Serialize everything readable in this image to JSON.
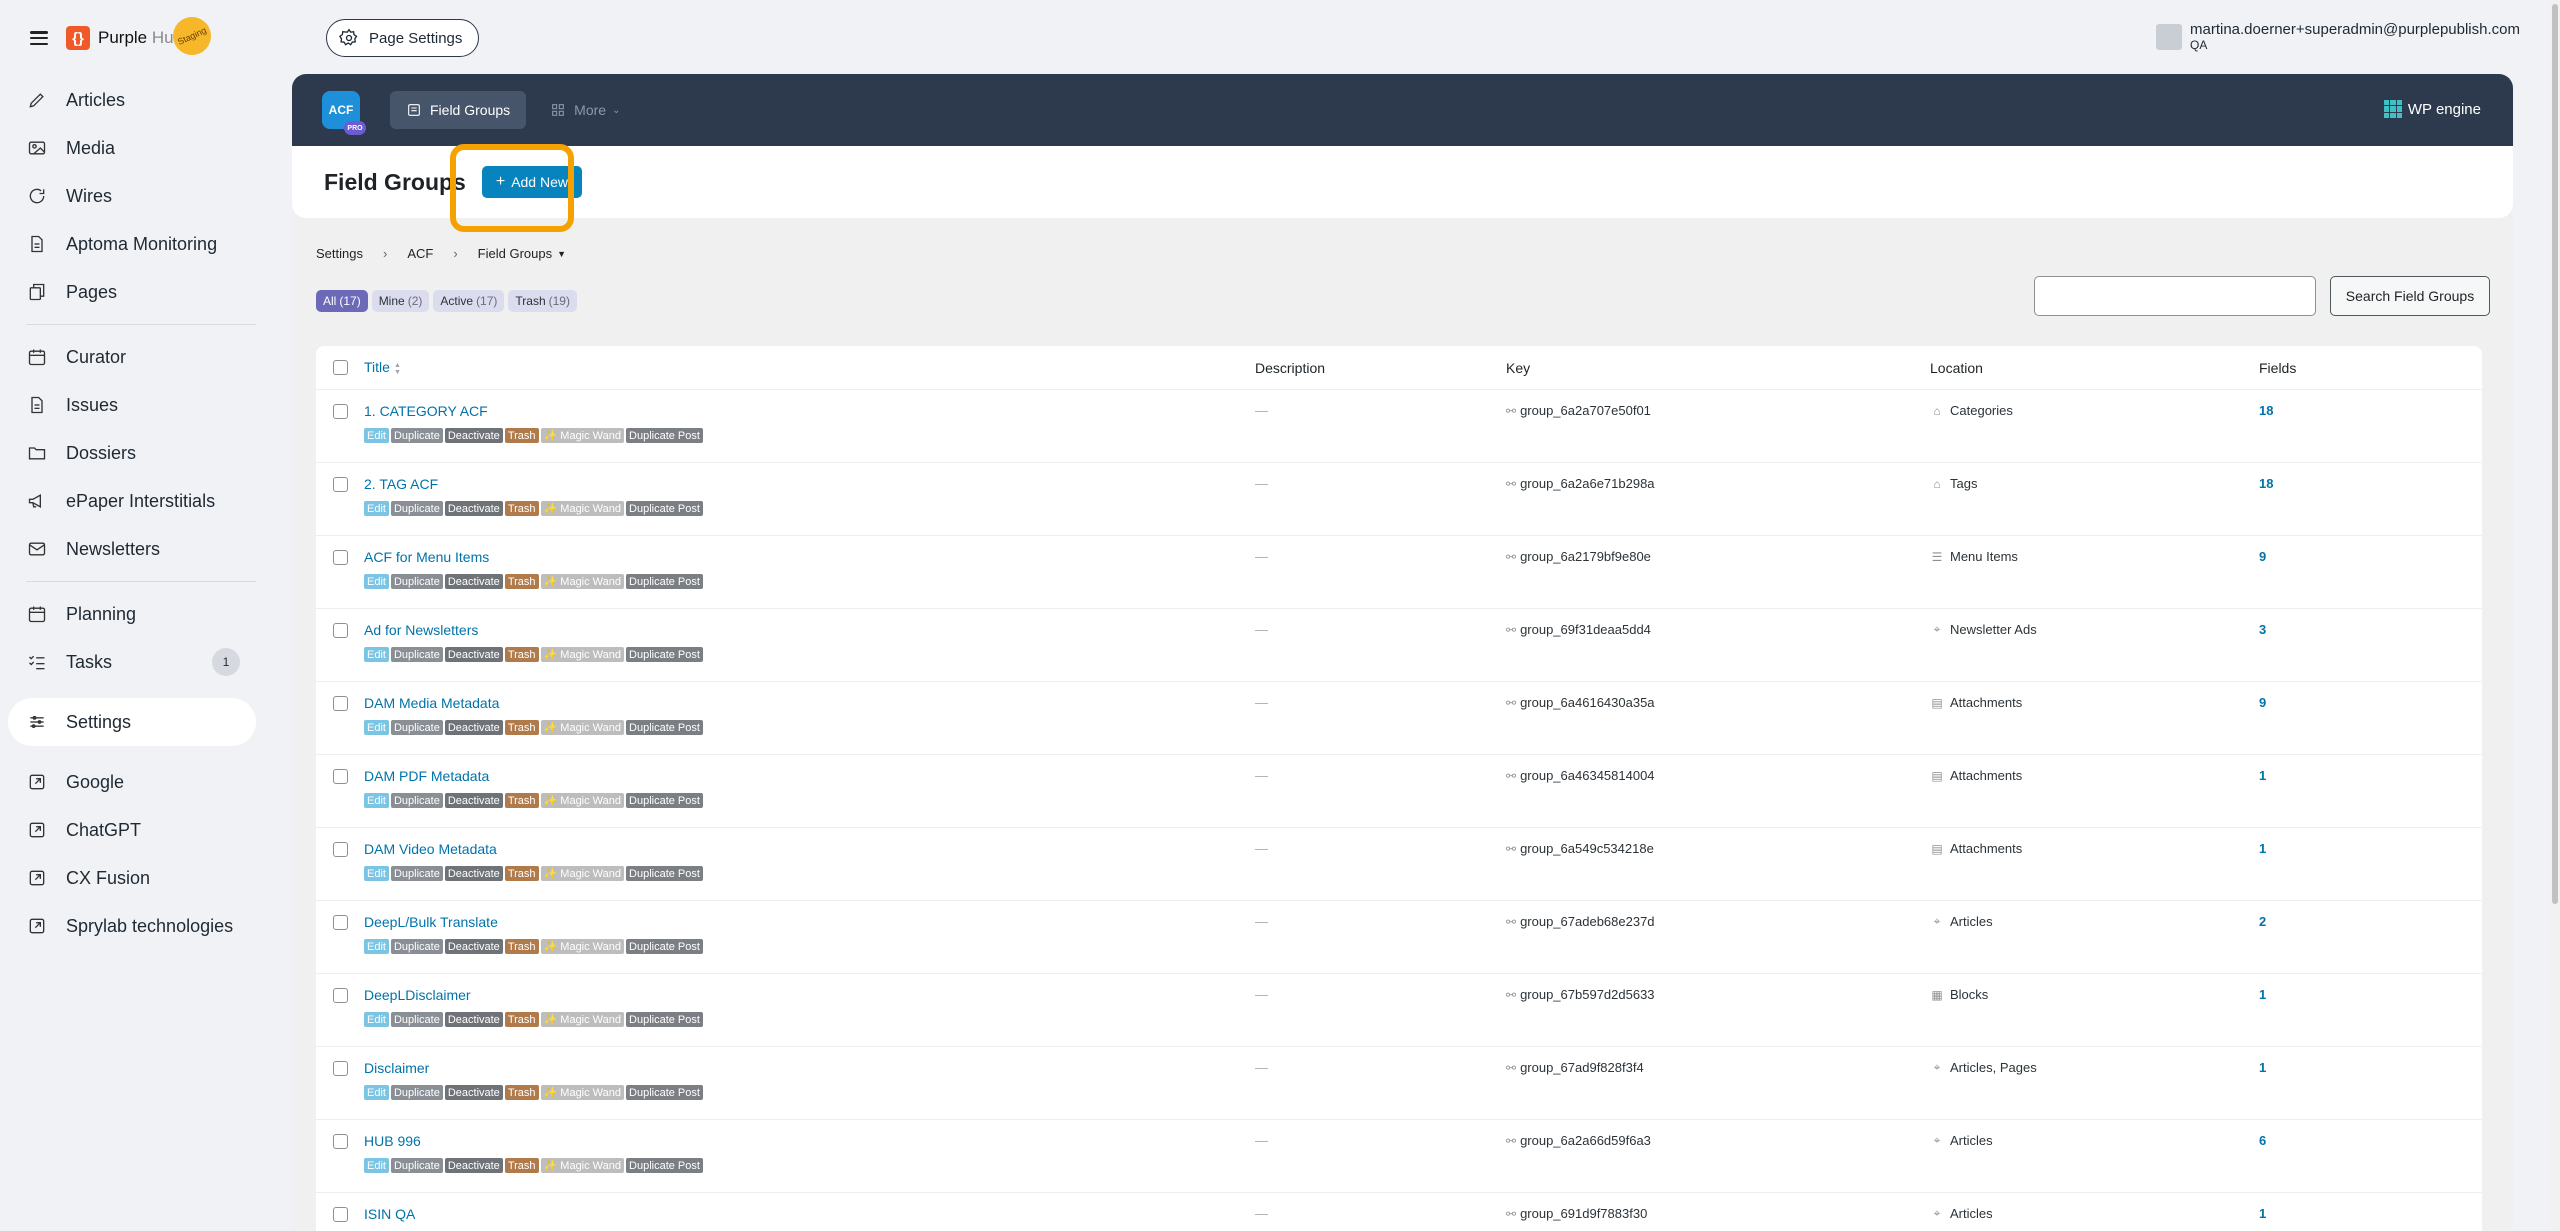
{
  "app": {
    "logo_brand": "Purple",
    "logo_suffix": "Hub",
    "staging_label": "Staging",
    "page_settings_label": "Page Settings",
    "user_email": "martina.doerner+superadmin@purplepublish.com",
    "user_org": "QA"
  },
  "sidebar": {
    "groups": [
      [
        {
          "label": "Articles",
          "icon": "pencil-icon"
        },
        {
          "label": "Media",
          "icon": "image-icon"
        },
        {
          "label": "Wires",
          "icon": "refresh-icon"
        },
        {
          "label": "Aptoma Monitoring",
          "icon": "document-icon"
        },
        {
          "label": "Pages",
          "icon": "pages-icon"
        }
      ],
      [
        {
          "label": "Curator",
          "icon": "calendar-icon"
        },
        {
          "label": "Issues",
          "icon": "document-icon"
        },
        {
          "label": "Dossiers",
          "icon": "folder-icon"
        },
        {
          "label": "ePaper Interstitials",
          "icon": "megaphone-icon"
        },
        {
          "label": "Newsletters",
          "icon": "mail-icon"
        }
      ],
      [
        {
          "label": "Planning",
          "icon": "calendar-icon"
        },
        {
          "label": "Tasks",
          "icon": "tasks-icon",
          "badge": "1"
        }
      ],
      [
        {
          "label": "Settings",
          "icon": "sliders-icon",
          "active": true
        }
      ],
      [
        {
          "label": "Google",
          "icon": "external-link-icon"
        },
        {
          "label": "ChatGPT",
          "icon": "external-link-icon"
        },
        {
          "label": "CX Fusion",
          "icon": "external-link-icon"
        },
        {
          "label": "Sprylab technologies",
          "icon": "external-link-icon"
        }
      ]
    ]
  },
  "acf": {
    "logo_text": "ACF",
    "logo_badge": "PRO",
    "tabs": [
      {
        "label": "Field Groups",
        "active": true
      },
      {
        "label": "More",
        "active": false
      }
    ],
    "partner": "WP engine"
  },
  "header": {
    "title": "Field Groups",
    "add_new_label": "Add New"
  },
  "breadcrumb": [
    "Settings",
    "ACF",
    "Field Groups"
  ],
  "filters": [
    {
      "label": "All",
      "count": "(17)",
      "active": true
    },
    {
      "label": "Mine",
      "count": "(2)",
      "active": false
    },
    {
      "label": "Active",
      "count": "(17)",
      "active": false
    },
    {
      "label": "Trash",
      "count": "(19)",
      "active": false
    }
  ],
  "search": {
    "button_label": "Search Field Groups",
    "value": ""
  },
  "table": {
    "columns": [
      "Title",
      "Description",
      "Key",
      "Location",
      "Fields"
    ],
    "row_actions": [
      "Edit",
      "Duplicate",
      "Deactivate",
      "Trash",
      "✨ Magic Wand",
      "Duplicate Post"
    ],
    "rows": [
      {
        "title": "1. CATEGORY ACF",
        "description": "—",
        "key": "group_6a2a707e50f01",
        "location": "Categories",
        "loc_icon": "tag-icon",
        "fields": "18"
      },
      {
        "title": "2. TAG ACF",
        "description": "—",
        "key": "group_6a2a6e71b298a",
        "location": "Tags",
        "loc_icon": "tag-icon",
        "fields": "18"
      },
      {
        "title": "ACF for Menu Items",
        "description": "—",
        "key": "group_6a2179bf9e80e",
        "location": "Menu Items",
        "loc_icon": "menu-icon",
        "fields": "9"
      },
      {
        "title": "Ad for Newsletters",
        "description": "—",
        "key": "group_69f31deaa5dd4",
        "location": "Newsletter Ads",
        "loc_icon": "pin-icon",
        "fields": "3"
      },
      {
        "title": "DAM Media Metadata",
        "description": "—",
        "key": "group_6a4616430a35a",
        "location": "Attachments",
        "loc_icon": "media-icon",
        "fields": "9"
      },
      {
        "title": "DAM PDF Metadata",
        "description": "—",
        "key": "group_6a46345814004",
        "location": "Attachments",
        "loc_icon": "media-icon",
        "fields": "1"
      },
      {
        "title": "DAM Video Metadata",
        "description": "—",
        "key": "group_6a549c534218e",
        "location": "Attachments",
        "loc_icon": "media-icon",
        "fields": "1"
      },
      {
        "title": "DeepL/Bulk Translate",
        "description": "—",
        "key": "group_67adeb68e237d",
        "location": "Articles",
        "loc_icon": "pin-icon",
        "fields": "2"
      },
      {
        "title": "DeepLDisclaimer",
        "description": "—",
        "key": "group_67b597d2d5633",
        "location": "Blocks",
        "loc_icon": "blocks-icon",
        "fields": "1"
      },
      {
        "title": "Disclaimer",
        "description": "—",
        "key": "group_67ad9f828f3f4",
        "location": "Articles, Pages",
        "loc_icon": "pin-icon",
        "fields": "1"
      },
      {
        "title": "HUB 996",
        "description": "—",
        "key": "group_6a2a66d59f6a3",
        "location": "Articles",
        "loc_icon": "pin-icon",
        "fields": "6"
      },
      {
        "title": "ISIN QA",
        "description": "—",
        "key": "group_691d9f7883f30",
        "location": "Articles",
        "loc_icon": "pin-icon",
        "fields": "1"
      }
    ]
  }
}
